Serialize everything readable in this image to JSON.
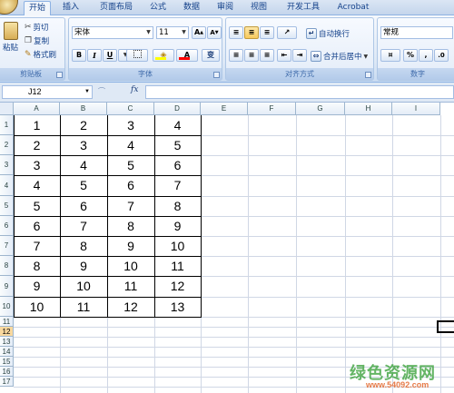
{
  "tabs": [
    "开始",
    "插入",
    "页面布局",
    "公式",
    "数据",
    "审阅",
    "视图",
    "开发工具",
    "Acrobat"
  ],
  "ribbon": {
    "clipboard": {
      "paste": "粘贴",
      "cut": "剪切",
      "copy": "复制",
      "format_painter": "格式刷",
      "label": "剪贴板"
    },
    "font": {
      "font_name": "宋体",
      "font_size": "11",
      "grow": "A",
      "shrink": "A",
      "bold": "B",
      "italic": "I",
      "underline": "U",
      "font_color_letter": "A",
      "phonetic": "变",
      "label": "字体"
    },
    "alignment": {
      "wrap_text": "自动换行",
      "merge_center": "合并后居中",
      "label": "对齐方式"
    },
    "number": {
      "format": "常规",
      "percent": "%",
      "comma": ",",
      "label": "数字"
    }
  },
  "formula_bar": {
    "name_box": "J12",
    "fx": "fx",
    "formula": ""
  },
  "sheet": {
    "columns": [
      "A",
      "B",
      "C",
      "D",
      "E",
      "F",
      "G",
      "H",
      "I"
    ],
    "rows": [
      "1",
      "2",
      "3",
      "4",
      "5",
      "6",
      "7",
      "8",
      "9",
      "10",
      "11",
      "12",
      "13",
      "14",
      "15",
      "16",
      "17"
    ],
    "selected_row": "12",
    "cells": [
      [
        "1",
        "2",
        "3",
        "4"
      ],
      [
        "2",
        "3",
        "4",
        "5"
      ],
      [
        "3",
        "4",
        "5",
        "6"
      ],
      [
        "4",
        "5",
        "6",
        "7"
      ],
      [
        "5",
        "6",
        "7",
        "8"
      ],
      [
        "6",
        "7",
        "8",
        "9"
      ],
      [
        "7",
        "8",
        "9",
        "10"
      ],
      [
        "8",
        "9",
        "10",
        "11"
      ],
      [
        "9",
        "10",
        "11",
        "12"
      ],
      [
        "10",
        "11",
        "12",
        "13"
      ]
    ]
  },
  "watermark": {
    "logo": "绿色资源网",
    "url": "www.54092.com"
  }
}
